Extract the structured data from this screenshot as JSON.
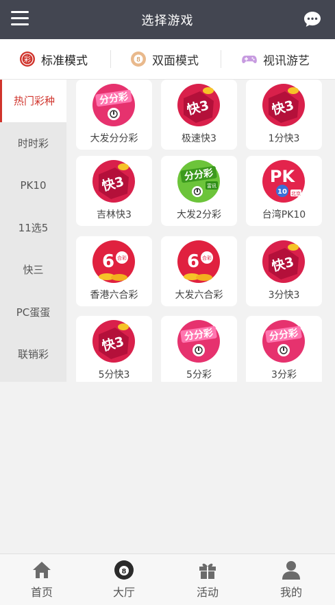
{
  "header": {
    "title": "选择游戏"
  },
  "modes": [
    {
      "label": "标准模式",
      "icon": "cai-lottery-icon",
      "active": true
    },
    {
      "label": "双面模式",
      "icon": "eight-ball-icon",
      "active": false
    },
    {
      "label": "视讯游艺",
      "icon": "gamepad-icon",
      "active": false
    }
  ],
  "sidebar": {
    "items": [
      {
        "label": "热门彩种",
        "active": true
      },
      {
        "label": "时时彩",
        "active": false
      },
      {
        "label": "PK10",
        "active": false
      },
      {
        "label": "11选5",
        "active": false
      },
      {
        "label": "快三",
        "active": false
      },
      {
        "label": "PC蛋蛋",
        "active": false
      },
      {
        "label": "联销彩",
        "active": false
      }
    ]
  },
  "games": [
    {
      "name": "大发分分彩",
      "logo": "fenfencai-logo"
    },
    {
      "name": "极速快3",
      "logo": "kuai3-logo"
    },
    {
      "name": "1分快3",
      "logo": "kuai3-logo"
    },
    {
      "name": "吉林快3",
      "logo": "kuai3-logo"
    },
    {
      "name": "大发2分彩",
      "logo": "fenfencai-green-logo"
    },
    {
      "name": "台湾PK10",
      "logo": "pk10-logo"
    },
    {
      "name": "香港六合彩",
      "logo": "liuhecai-logo"
    },
    {
      "name": "大发六合彩",
      "logo": "liuhecai-logo"
    },
    {
      "name": "3分快3",
      "logo": "kuai3-logo"
    },
    {
      "name": "5分快3",
      "logo": "kuai3-logo"
    },
    {
      "name": "5分彩",
      "logo": "fenfencai-logo"
    },
    {
      "name": "3分彩",
      "logo": "fenfencai-logo"
    }
  ],
  "logo_text": {
    "fenfencai": "分分彩",
    "kuai3": "快3",
    "pk": "PK",
    "pk_num": "10",
    "pk_region": "北京",
    "liuhe_num": "6",
    "liuhe_tag": "合彩",
    "green_tag": "富讯"
  },
  "tabbar": [
    {
      "label": "首页",
      "icon": "home-icon"
    },
    {
      "label": "大厅",
      "icon": "eight-ball-icon"
    },
    {
      "label": "活动",
      "icon": "gift-icon"
    },
    {
      "label": "我的",
      "icon": "user-icon"
    }
  ],
  "colors": {
    "header_bg": "#434651",
    "accent_red": "#d0342c",
    "sidebar_bg": "#e8e8e8"
  }
}
